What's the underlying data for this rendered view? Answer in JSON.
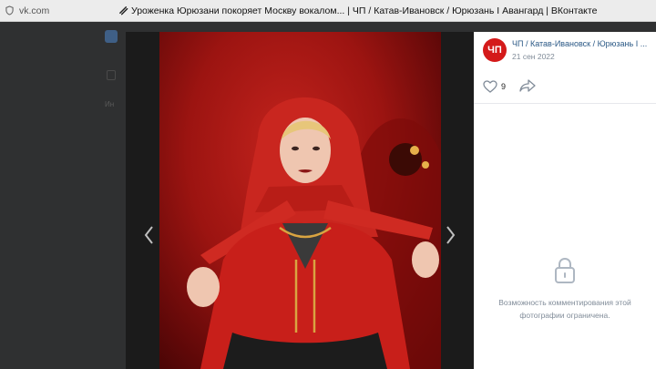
{
  "browser": {
    "url": "vk.com",
    "tab_title": "Уроженка Юрюзани покоряет Москву вокалом... | ЧП / Катав-Ивановск / Юрюзань I Авангард | ВКонтакте"
  },
  "background": {
    "vk_logo_icon": "vk-logo-icon",
    "stub_text": "Ин"
  },
  "viewer": {
    "photo_icon": "woman-red-headscarf-photo",
    "prev_icon": "chevron-left-icon",
    "next_icon": "chevron-right-icon"
  },
  "sidebar": {
    "avatar_text": "ЧП",
    "author": "ЧП / Катав-Ивановск / Юрюзань I ...",
    "date": "21 сен 2022",
    "likes": "9",
    "restricted_text": "Возможность комментирования этой фотографии ограничена."
  },
  "colors": {
    "accent_red": "#d41a1a",
    "link": "#2a5885",
    "muted": "#818c99"
  }
}
